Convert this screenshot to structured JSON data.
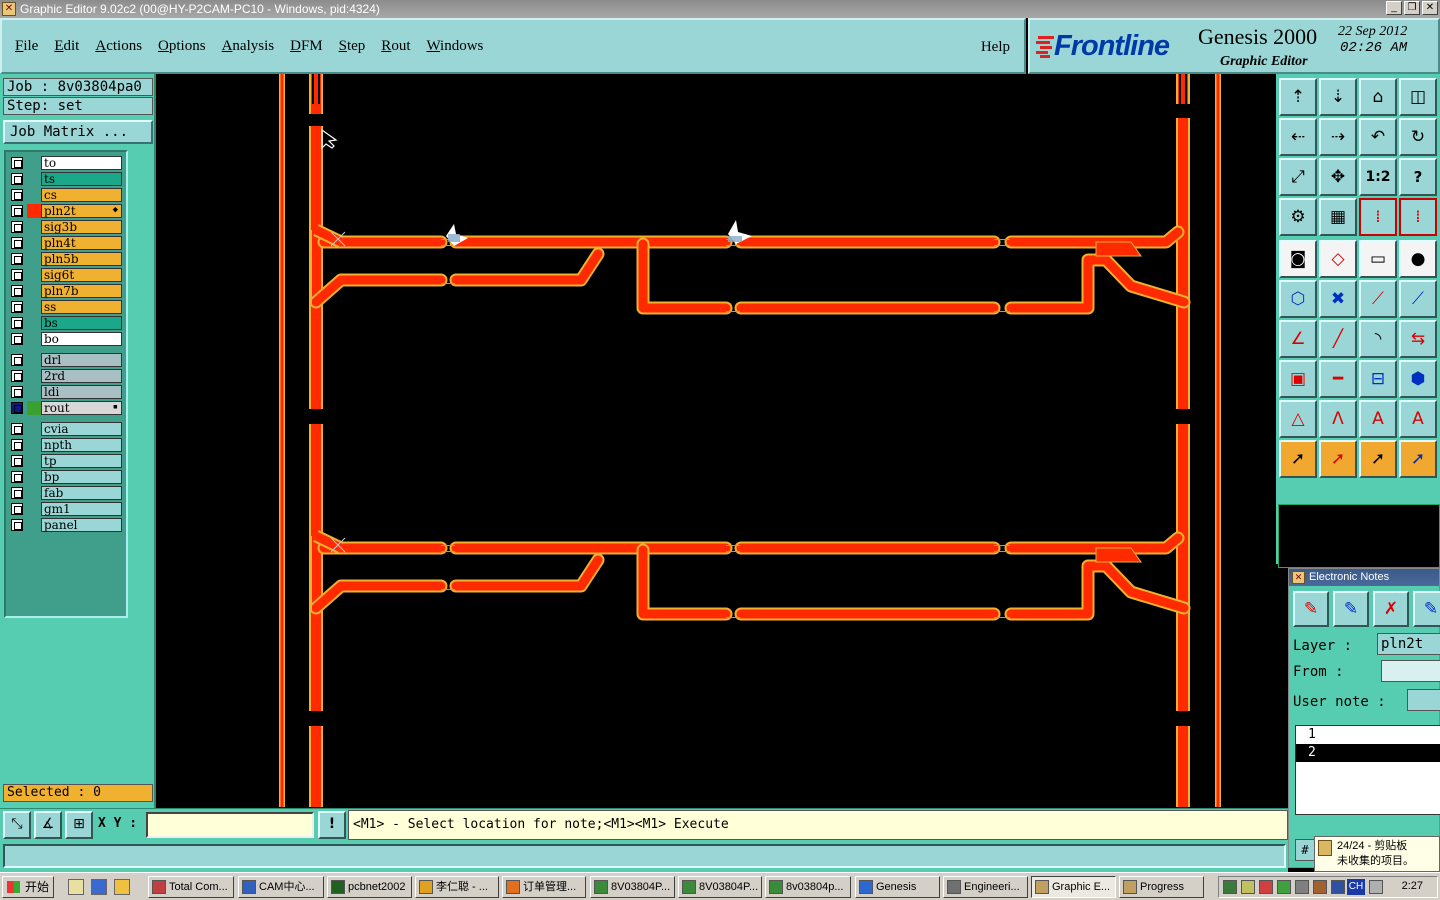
{
  "window": {
    "title": "Graphic Editor 9.02c2 (00@HY-P2CAM-PC10 - Windows, pid:4324)",
    "minimize": "_",
    "restore": "❐",
    "close": "✕"
  },
  "menu": {
    "items": [
      "File",
      "Edit",
      "Actions",
      "Options",
      "Analysis",
      "DFM",
      "Step",
      "Rout",
      "Windows"
    ],
    "help": "Help"
  },
  "logo": {
    "brand": "Frontline",
    "product": "Genesis 2000",
    "subtitle": "Graphic Editor",
    "date": "22  Sep  2012",
    "time": "02:26  AM"
  },
  "job": {
    "job_line": "Job : 8v03804pa0",
    "step_line": "Step: set",
    "matrix_button": "Job Matrix ..."
  },
  "layers": {
    "group1": [
      {
        "name": "to",
        "color": "#ffffff"
      },
      {
        "name": "ts",
        "color": "#1ba88a"
      },
      {
        "name": "cs",
        "color": "#f0b030"
      },
      {
        "name": "pln2t",
        "color": "#f0b030",
        "active": true,
        "swatch": "#ff2a00"
      },
      {
        "name": "sig3b",
        "color": "#f0b030"
      },
      {
        "name": "pln4t",
        "color": "#f0b030"
      },
      {
        "name": "pln5b",
        "color": "#f0b030"
      },
      {
        "name": "sig6t",
        "color": "#f0b030"
      },
      {
        "name": "pln7b",
        "color": "#f0b030"
      },
      {
        "name": "ss",
        "color": "#f0b030"
      },
      {
        "name": "bs",
        "color": "#1ba88a"
      },
      {
        "name": "bo",
        "color": "#ffffff"
      }
    ],
    "group2": [
      {
        "name": "drl",
        "color": "#a9bfc4"
      },
      {
        "name": "2rd",
        "color": "#a9bfc4"
      },
      {
        "name": "ldi",
        "color": "#a9bfc4"
      },
      {
        "name": "rout",
        "color": "#d8d8d8",
        "checked": true,
        "swatch": "#3aa030"
      }
    ],
    "group3": [
      {
        "name": "cvia",
        "color": "#9ad6d6"
      },
      {
        "name": "npth",
        "color": "#9ad6d6"
      },
      {
        "name": "tp",
        "color": "#9ad6d6"
      },
      {
        "name": "bp",
        "color": "#9ad6d6"
      },
      {
        "name": "fab",
        "color": "#9ad6d6"
      },
      {
        "name": "gm1",
        "color": "#9ad6d6"
      },
      {
        "name": "panel",
        "color": "#9ad6d6"
      }
    ]
  },
  "selected_text": "Selected : 0",
  "toolbar": {
    "zoom_half": "1:2",
    "help_q": "?"
  },
  "notes": {
    "title": "Electronic Notes",
    "layer_label": "Layer :",
    "layer_value": "pln2t",
    "from_label": "From :",
    "from_value": "",
    "user_note_label": "User note :",
    "items": [
      "1",
      "2"
    ],
    "footer_button": "#"
  },
  "status": {
    "xy_label": "X Y :",
    "xy_value": "",
    "bang": "!",
    "prompt": "<M1> - Select location for note;<M1><M1> Execute"
  },
  "clipboard_tip": {
    "line1": "24/24 - 剪贴板",
    "line2": "未收集的项目。"
  },
  "taskbar": {
    "start": "开始",
    "tasks": [
      "Total Com...",
      "CAM中心...",
      "pcbnet2002",
      "李仁聪 - ...",
      "订单管理...",
      "8V03804P...",
      "8V03804P...",
      "8v03804p...",
      "Genesis",
      "Engineeri...",
      "Graphic E...",
      "Progress"
    ],
    "ime": "CH",
    "clock": "2:27"
  },
  "colors": {
    "trace": "#ff2a00",
    "trace_outline": "#f0b030",
    "panel_teal": "#56cdb0",
    "menu_cyan": "#9ad6d6"
  }
}
